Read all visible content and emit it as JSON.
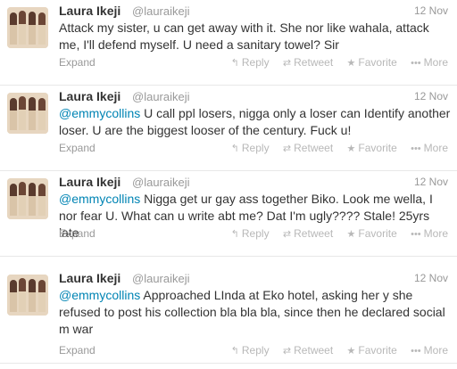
{
  "tweets": [
    {
      "fullname": "Laura Ikeji",
      "username": "@lauraikeji",
      "time": "12 Nov",
      "mention": "",
      "text": "Attack my sister, u can get away with it. She nor like wahala, attack me, I'll defend myself. U need a  sanitary towel? Sir",
      "expand": "Expand",
      "actions": {
        "reply": "Reply",
        "retweet": "Retweet",
        "favorite": "Favorite",
        "more": "More"
      }
    },
    {
      "fullname": "Laura Ikeji",
      "username": "@lauraikeji",
      "time": "12 Nov",
      "mention": "@emmycollins",
      "text": " U call ppl losers, nigga only a loser can Identify another loser. U are the biggest looser of the century. Fuck u!",
      "expand": "Expand",
      "actions": {
        "reply": "Reply",
        "retweet": "Retweet",
        "favorite": "Favorite",
        "more": "More"
      }
    },
    {
      "fullname": "Laura Ikeji",
      "username": "@lauraikeji",
      "time": "12 Nov",
      "mention": "@emmycollins",
      "text": " Nigga get ur gay ass together Biko. Look me wella, I nor fear U. What can u write abt me? Dat I'm ugly???? Stale! 25yrs late",
      "expand": "Expand",
      "actions": {
        "reply": "Reply",
        "retweet": "Retweet",
        "favorite": "Favorite",
        "more": "More"
      }
    },
    {
      "fullname": "Laura Ikeji",
      "username": "@lauraikeji",
      "time": "12 Nov",
      "mention": "@emmycollins",
      "text": " Approached LInda at Eko hotel, asking her y she refused to post his collection bla bla bla, since then he declared social m war",
      "expand": "Expand",
      "actions": {
        "reply": "Reply",
        "retweet": "Retweet",
        "favorite": "Favorite",
        "more": "More"
      }
    }
  ],
  "colors": {
    "mention": "#0084b4",
    "muted": "#999999",
    "text": "#333333"
  },
  "icons": {
    "reply": "reply-arrow-icon",
    "retweet": "retweet-icon",
    "favorite": "star-icon",
    "more": "ellipsis-icon"
  }
}
